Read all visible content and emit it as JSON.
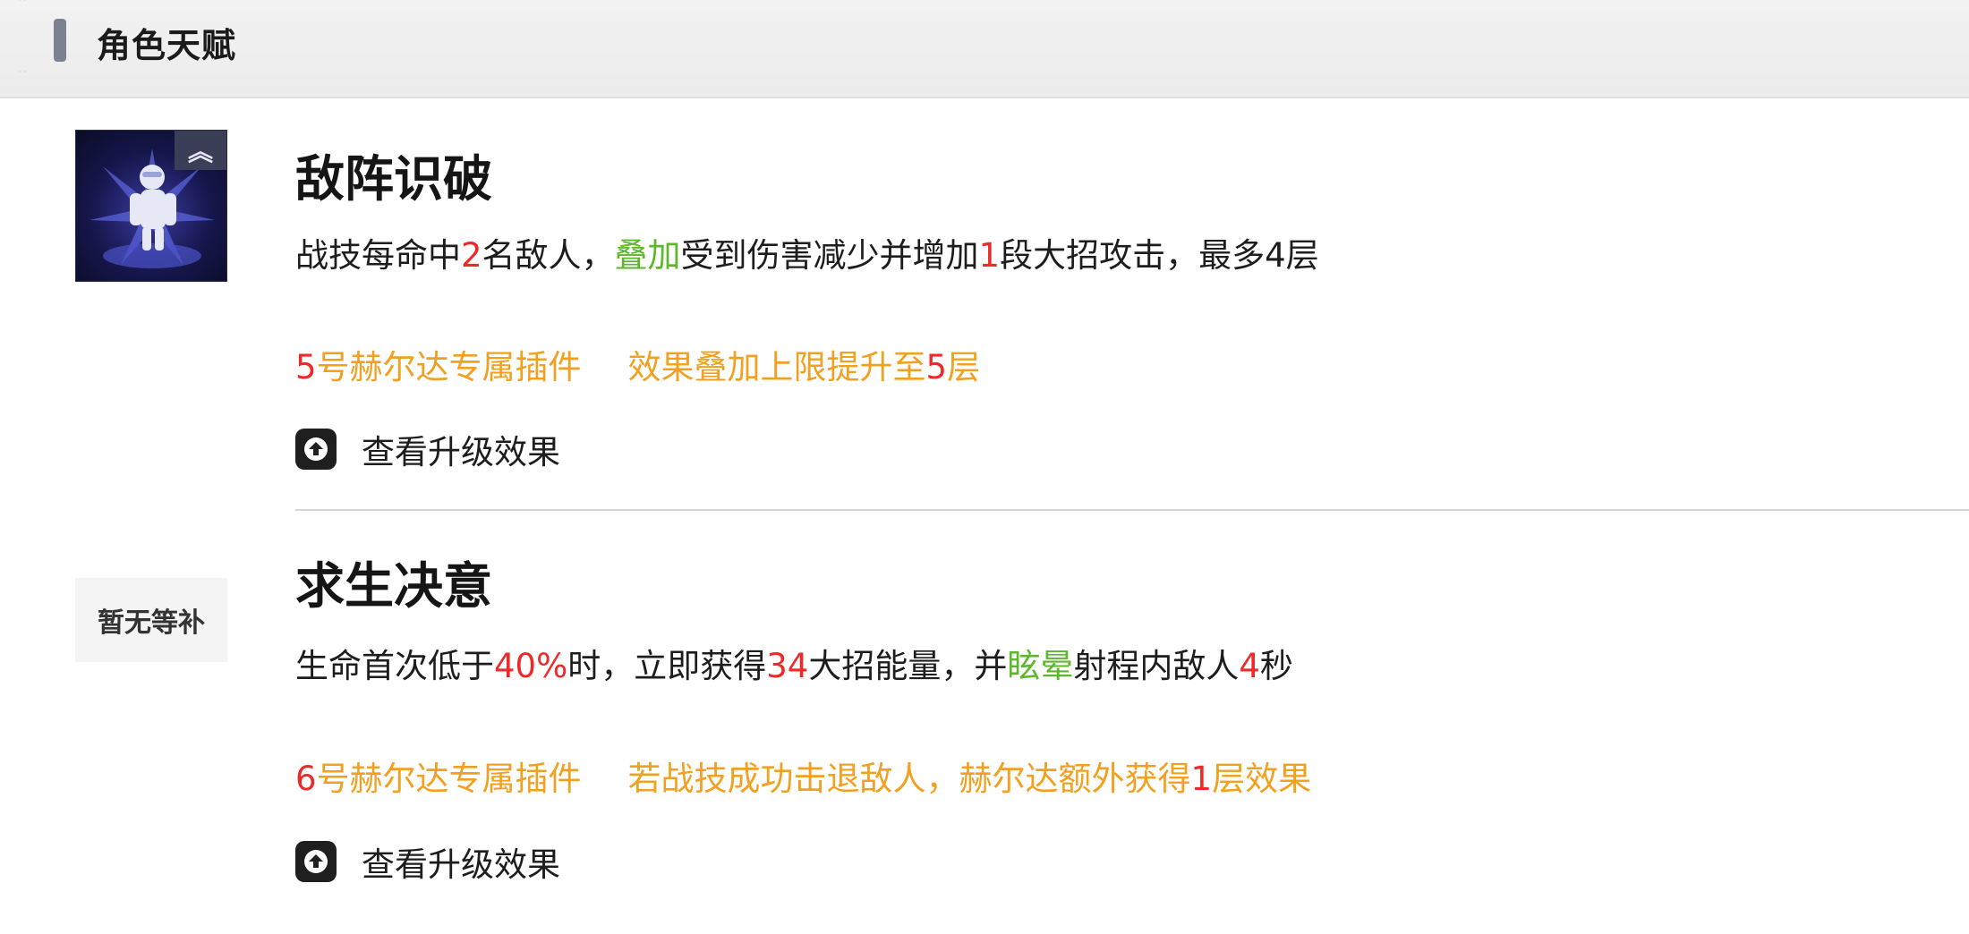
{
  "header": {
    "title": "角色天赋"
  },
  "talents": [
    {
      "title": "敌阵识破",
      "icon": "character-skill-icon",
      "upgrade_badge": "︽",
      "desc": {
        "p1": "战技每命中",
        "v1": "2",
        "p2": "名敌人，",
        "g1": "叠加",
        "p3": "受到伤害减少并增加",
        "v2": "1",
        "p4": "段大招攻击，最多4层"
      },
      "plugin": {
        "num": "5",
        "name": "号赫尔达专属插件",
        "effect_prefix": "效果叠加上限提升至",
        "effect_value": "5",
        "effect_suffix": "层"
      },
      "upgrade_label": "查看升级效果"
    },
    {
      "title": "求生决意",
      "placeholder_text": "暂无等补",
      "desc": {
        "p1": "生命首次低于",
        "v1": "40%",
        "p2": "时，立即获得",
        "v2": "34",
        "p3": "大招能量，并",
        "g1": "眩晕",
        "p4": "射程内敌人",
        "v3": "4",
        "p5": "秒"
      },
      "plugin": {
        "num": "6",
        "name": "号赫尔达专属插件",
        "effect_prefix": "若战技成功击退敌人，赫尔达额外获得",
        "effect_value": "1",
        "effect_suffix": "层效果"
      },
      "upgrade_label": "查看升级效果"
    }
  ],
  "colors": {
    "accent_red": "#ec2a2a",
    "accent_green": "#5cb82a",
    "accent_orange": "#f2a020"
  }
}
